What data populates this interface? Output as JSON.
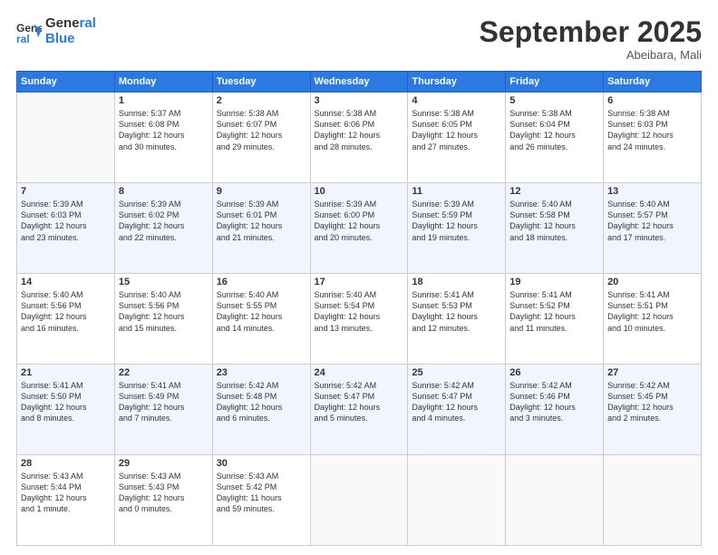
{
  "logo": {
    "line1": "General",
    "line2": "Blue"
  },
  "header": {
    "month": "September 2025",
    "location": "Abeibara, Mali"
  },
  "weekdays": [
    "Sunday",
    "Monday",
    "Tuesday",
    "Wednesday",
    "Thursday",
    "Friday",
    "Saturday"
  ],
  "weeks": [
    [
      {
        "day": "",
        "info": ""
      },
      {
        "day": "1",
        "info": "Sunrise: 5:37 AM\nSunset: 6:08 PM\nDaylight: 12 hours\nand 30 minutes."
      },
      {
        "day": "2",
        "info": "Sunrise: 5:38 AM\nSunset: 6:07 PM\nDaylight: 12 hours\nand 29 minutes."
      },
      {
        "day": "3",
        "info": "Sunrise: 5:38 AM\nSunset: 6:06 PM\nDaylight: 12 hours\nand 28 minutes."
      },
      {
        "day": "4",
        "info": "Sunrise: 5:38 AM\nSunset: 6:05 PM\nDaylight: 12 hours\nand 27 minutes."
      },
      {
        "day": "5",
        "info": "Sunrise: 5:38 AM\nSunset: 6:04 PM\nDaylight: 12 hours\nand 26 minutes."
      },
      {
        "day": "6",
        "info": "Sunrise: 5:38 AM\nSunset: 6:03 PM\nDaylight: 12 hours\nand 24 minutes."
      }
    ],
    [
      {
        "day": "7",
        "info": "Sunrise: 5:39 AM\nSunset: 6:03 PM\nDaylight: 12 hours\nand 23 minutes."
      },
      {
        "day": "8",
        "info": "Sunrise: 5:39 AM\nSunset: 6:02 PM\nDaylight: 12 hours\nand 22 minutes."
      },
      {
        "day": "9",
        "info": "Sunrise: 5:39 AM\nSunset: 6:01 PM\nDaylight: 12 hours\nand 21 minutes."
      },
      {
        "day": "10",
        "info": "Sunrise: 5:39 AM\nSunset: 6:00 PM\nDaylight: 12 hours\nand 20 minutes."
      },
      {
        "day": "11",
        "info": "Sunrise: 5:39 AM\nSunset: 5:59 PM\nDaylight: 12 hours\nand 19 minutes."
      },
      {
        "day": "12",
        "info": "Sunrise: 5:40 AM\nSunset: 5:58 PM\nDaylight: 12 hours\nand 18 minutes."
      },
      {
        "day": "13",
        "info": "Sunrise: 5:40 AM\nSunset: 5:57 PM\nDaylight: 12 hours\nand 17 minutes."
      }
    ],
    [
      {
        "day": "14",
        "info": "Sunrise: 5:40 AM\nSunset: 5:56 PM\nDaylight: 12 hours\nand 16 minutes."
      },
      {
        "day": "15",
        "info": "Sunrise: 5:40 AM\nSunset: 5:56 PM\nDaylight: 12 hours\nand 15 minutes."
      },
      {
        "day": "16",
        "info": "Sunrise: 5:40 AM\nSunset: 5:55 PM\nDaylight: 12 hours\nand 14 minutes."
      },
      {
        "day": "17",
        "info": "Sunrise: 5:40 AM\nSunset: 5:54 PM\nDaylight: 12 hours\nand 13 minutes."
      },
      {
        "day": "18",
        "info": "Sunrise: 5:41 AM\nSunset: 5:53 PM\nDaylight: 12 hours\nand 12 minutes."
      },
      {
        "day": "19",
        "info": "Sunrise: 5:41 AM\nSunset: 5:52 PM\nDaylight: 12 hours\nand 11 minutes."
      },
      {
        "day": "20",
        "info": "Sunrise: 5:41 AM\nSunset: 5:51 PM\nDaylight: 12 hours\nand 10 minutes."
      }
    ],
    [
      {
        "day": "21",
        "info": "Sunrise: 5:41 AM\nSunset: 5:50 PM\nDaylight: 12 hours\nand 8 minutes."
      },
      {
        "day": "22",
        "info": "Sunrise: 5:41 AM\nSunset: 5:49 PM\nDaylight: 12 hours\nand 7 minutes."
      },
      {
        "day": "23",
        "info": "Sunrise: 5:42 AM\nSunset: 5:48 PM\nDaylight: 12 hours\nand 6 minutes."
      },
      {
        "day": "24",
        "info": "Sunrise: 5:42 AM\nSunset: 5:47 PM\nDaylight: 12 hours\nand 5 minutes."
      },
      {
        "day": "25",
        "info": "Sunrise: 5:42 AM\nSunset: 5:47 PM\nDaylight: 12 hours\nand 4 minutes."
      },
      {
        "day": "26",
        "info": "Sunrise: 5:42 AM\nSunset: 5:46 PM\nDaylight: 12 hours\nand 3 minutes."
      },
      {
        "day": "27",
        "info": "Sunrise: 5:42 AM\nSunset: 5:45 PM\nDaylight: 12 hours\nand 2 minutes."
      }
    ],
    [
      {
        "day": "28",
        "info": "Sunrise: 5:43 AM\nSunset: 5:44 PM\nDaylight: 12 hours\nand 1 minute."
      },
      {
        "day": "29",
        "info": "Sunrise: 5:43 AM\nSunset: 5:43 PM\nDaylight: 12 hours\nand 0 minutes."
      },
      {
        "day": "30",
        "info": "Sunrise: 5:43 AM\nSunset: 5:42 PM\nDaylight: 11 hours\nand 59 minutes."
      },
      {
        "day": "",
        "info": ""
      },
      {
        "day": "",
        "info": ""
      },
      {
        "day": "",
        "info": ""
      },
      {
        "day": "",
        "info": ""
      }
    ]
  ]
}
